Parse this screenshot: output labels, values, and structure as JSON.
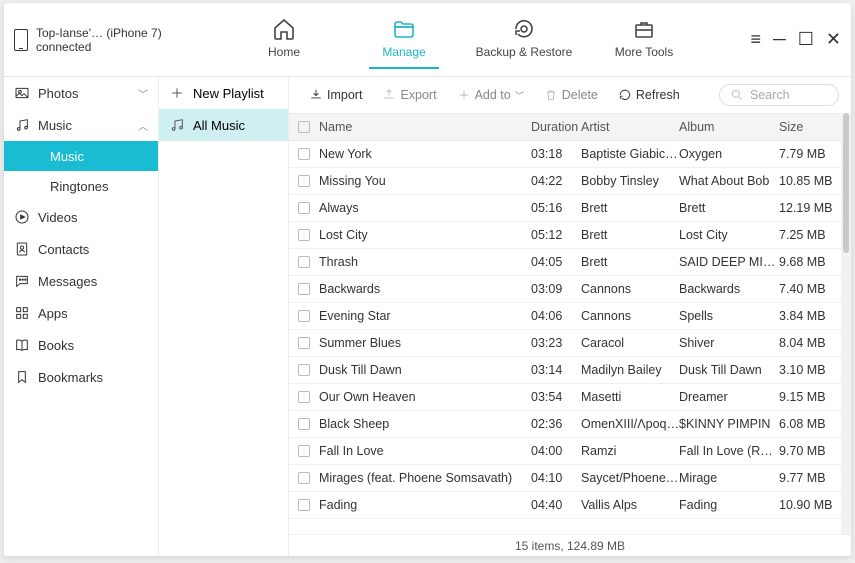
{
  "device": {
    "name": "Top-Ianse'… (iPhone 7)",
    "status": "connected"
  },
  "nav": {
    "home": "Home",
    "manage": "Manage",
    "backup": "Backup & Restore",
    "tools": "More Tools"
  },
  "sb1": {
    "photos": "Photos",
    "music": "Music",
    "music_sub": "Music",
    "ringtones": "Ringtones",
    "videos": "Videos",
    "contacts": "Contacts",
    "messages": "Messages",
    "apps": "Apps",
    "books": "Books",
    "bookmarks": "Bookmarks"
  },
  "sb2": {
    "new_playlist": "New Playlist",
    "all_music": "All Music"
  },
  "toolbar": {
    "import": "Import",
    "export": "Export",
    "addto": "Add to",
    "delete": "Delete",
    "refresh": "Refresh",
    "search_ph": "Search"
  },
  "cols": {
    "name": "Name",
    "duration": "Duration",
    "artist": "Artist",
    "album": "Album",
    "size": "Size"
  },
  "tracks": [
    {
      "name": "New York",
      "dur": "03:18",
      "artist": "Baptiste Giabiconi",
      "album": "Oxygen",
      "size": "7.79 MB"
    },
    {
      "name": "Missing You",
      "dur": "04:22",
      "artist": "Bobby Tinsley",
      "album": "What About Bob",
      "size": "10.85 MB"
    },
    {
      "name": "Always",
      "dur": "05:16",
      "artist": "Brett",
      "album": "Brett",
      "size": "12.19 MB"
    },
    {
      "name": "Lost City",
      "dur": "05:12",
      "artist": "Brett",
      "album": "Lost City",
      "size": "7.25 MB"
    },
    {
      "name": "Thrash",
      "dur": "04:05",
      "artist": "Brett",
      "album": "SAID DEEP MIXTAP…",
      "size": "9.68 MB"
    },
    {
      "name": "Backwards",
      "dur": "03:09",
      "artist": "Cannons",
      "album": "Backwards",
      "size": "7.40 MB"
    },
    {
      "name": "Evening Star",
      "dur": "04:06",
      "artist": "Cannons",
      "album": "Spells",
      "size": "3.84 MB"
    },
    {
      "name": "Summer Blues",
      "dur": "03:23",
      "artist": "Caracol",
      "album": "Shiver",
      "size": "8.04 MB"
    },
    {
      "name": "Dusk Till Dawn",
      "dur": "03:14",
      "artist": "Madilyn Bailey",
      "album": "Dusk Till Dawn",
      "size": "3.10 MB"
    },
    {
      "name": "Our Own Heaven",
      "dur": "03:54",
      "artist": "Masetti",
      "album": "Dreamer",
      "size": "9.15 MB"
    },
    {
      "name": "Black Sheep",
      "dur": "02:36",
      "artist": "OmenXIII/Λpoqou",
      "album": "$KINNY PIMPIN",
      "size": "6.08 MB"
    },
    {
      "name": "Fall In Love",
      "dur": "04:00",
      "artist": "Ramzi",
      "album": "Fall In Love (Radio…",
      "size": "9.70 MB"
    },
    {
      "name": "Mirages (feat. Phoene Somsavath)",
      "dur": "04:10",
      "artist": "Saycet/Phoene Som…",
      "album": "Mirage",
      "size": "9.77 MB"
    },
    {
      "name": "Fading",
      "dur": "04:40",
      "artist": "Vallis Alps",
      "album": "Fading",
      "size": "10.90 MB"
    }
  ],
  "status": "15 items, 124.89 MB"
}
